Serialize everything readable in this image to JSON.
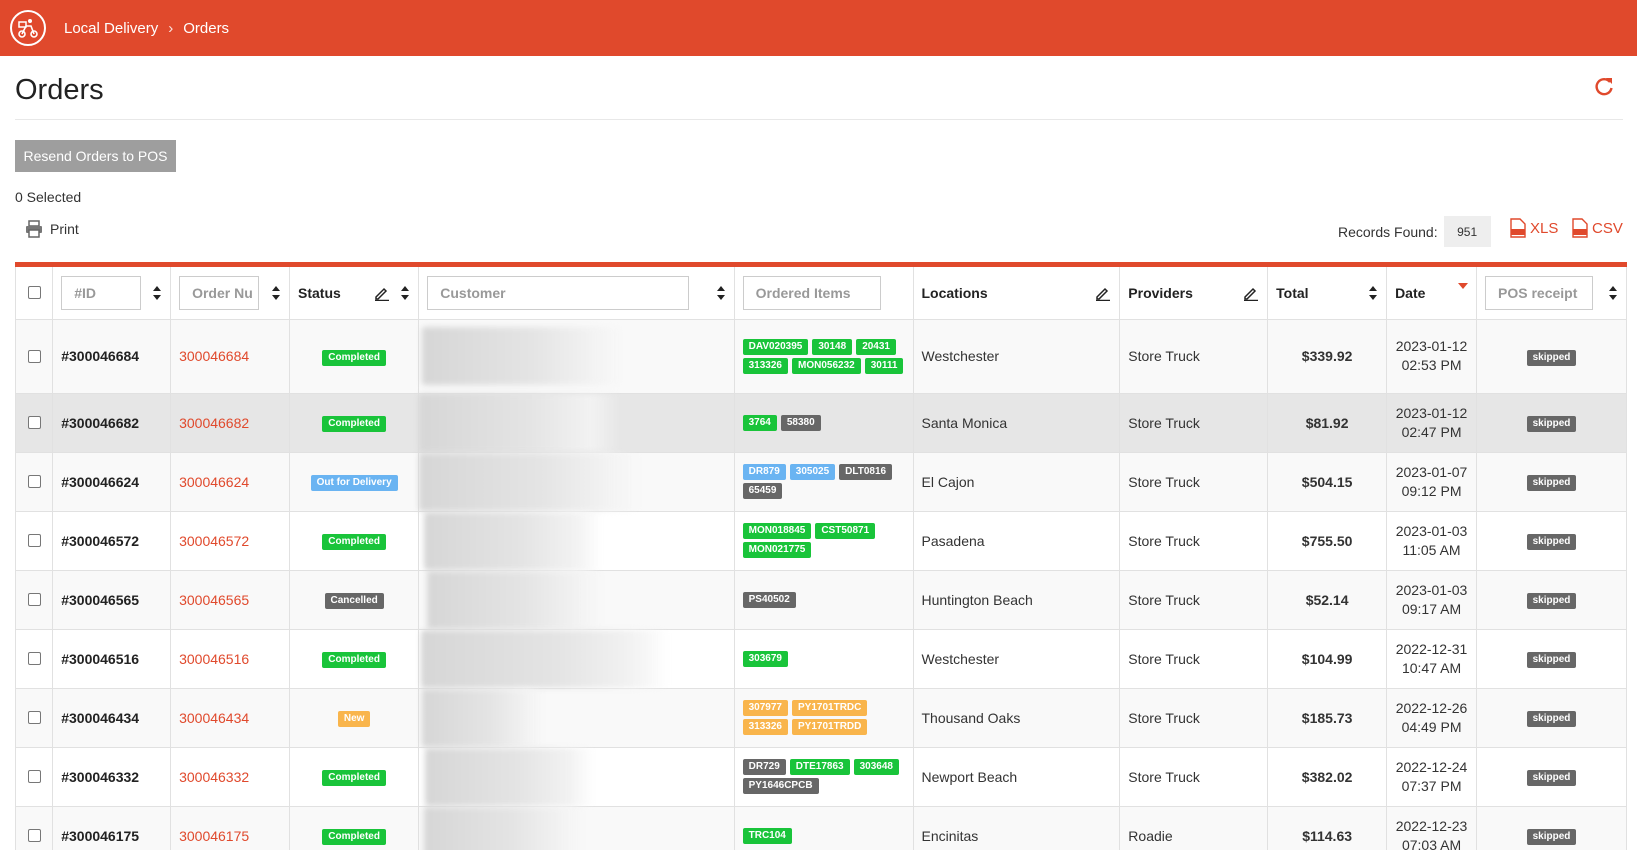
{
  "header": {
    "breadcrumb": [
      "Local Delivery",
      "Orders"
    ],
    "color": "#e0492c"
  },
  "page": {
    "title": "Orders",
    "resend_label": "Resend Orders to POS",
    "selected_text": "0 Selected",
    "print_label": "Print",
    "records_label": "Records Found:",
    "records_count": "951",
    "xls_label": "XLS",
    "csv_label": "CSV"
  },
  "table": {
    "filters": {
      "id_placeholder": "#ID",
      "order_placeholder": "Order Nu",
      "customer_placeholder": "Customer",
      "items_placeholder": "Ordered Items",
      "pos_placeholder": "POS receipt"
    },
    "headers": {
      "status": "Status",
      "locations": "Locations",
      "providers": "Providers",
      "total": "Total",
      "date": "Date"
    },
    "rows": [
      {
        "id": "#300046684",
        "order": "300046684",
        "status": "Completed",
        "status_type": "completed",
        "items": [
          {
            "label": "DAV020395",
            "color": "#19c43a"
          },
          {
            "label": "30148",
            "color": "#19c43a"
          },
          {
            "label": "20431",
            "color": "#19c43a"
          },
          {
            "label": "313326",
            "color": "#19c43a"
          },
          {
            "label": "MON056232",
            "color": "#19c43a"
          },
          {
            "label": "30111",
            "color": "#19c43a"
          }
        ],
        "location": "Westchester",
        "provider": "Store Truck",
        "total": "$339.92",
        "date": "2023-01-12",
        "time": "02:53 PM",
        "pos": "skipped"
      },
      {
        "id": "#300046682",
        "order": "300046682",
        "status": "Completed",
        "status_type": "completed",
        "items": [
          {
            "label": "3764",
            "color": "#19c43a"
          },
          {
            "label": "58380",
            "color": "#676767"
          }
        ],
        "location": "Santa Monica",
        "provider": "Store Truck",
        "total": "$81.92",
        "date": "2023-01-12",
        "time": "02:47 PM",
        "pos": "skipped"
      },
      {
        "id": "#300046624",
        "order": "300046624",
        "status": "Out for Delivery",
        "status_type": "out",
        "items": [
          {
            "label": "DR879",
            "color": "#6ab4f2"
          },
          {
            "label": "305025",
            "color": "#6ab4f2"
          },
          {
            "label": "DLT0816",
            "color": "#676767"
          },
          {
            "label": "65459",
            "color": "#676767"
          }
        ],
        "location": "El Cajon",
        "provider": "Store Truck",
        "total": "$504.15",
        "date": "2023-01-07",
        "time": "09:12 PM",
        "pos": "skipped"
      },
      {
        "id": "#300046572",
        "order": "300046572",
        "status": "Completed",
        "status_type": "completed",
        "items": [
          {
            "label": "MON018845",
            "color": "#19c43a"
          },
          {
            "label": "CST50871",
            "color": "#19c43a"
          },
          {
            "label": "MON021775",
            "color": "#19c43a"
          }
        ],
        "location": "Pasadena",
        "provider": "Store Truck",
        "total": "$755.50",
        "date": "2023-01-03",
        "time": "11:05 AM",
        "pos": "skipped"
      },
      {
        "id": "#300046565",
        "order": "300046565",
        "status": "Cancelled",
        "status_type": "cancelled",
        "items": [
          {
            "label": "PS40502",
            "color": "#676767"
          }
        ],
        "location": "Huntington Beach",
        "provider": "Store Truck",
        "total": "$52.14",
        "date": "2023-01-03",
        "time": "09:17 AM",
        "pos": "skipped"
      },
      {
        "id": "#300046516",
        "order": "300046516",
        "status": "Completed",
        "status_type": "completed",
        "items": [
          {
            "label": "303679",
            "color": "#19c43a"
          }
        ],
        "location": "Westchester",
        "provider": "Store Truck",
        "total": "$104.99",
        "date": "2022-12-31",
        "time": "10:47 AM",
        "pos": "skipped"
      },
      {
        "id": "#300046434",
        "order": "300046434",
        "status": "New",
        "status_type": "new",
        "items": [
          {
            "label": "307977",
            "color": "#f9b54c"
          },
          {
            "label": "PY1701TRDC",
            "color": "#f9b54c"
          },
          {
            "label": "313326",
            "color": "#f9b54c"
          },
          {
            "label": "PY1701TRDD",
            "color": "#f9b54c"
          }
        ],
        "location": "Thousand Oaks",
        "provider": "Store Truck",
        "total": "$185.73",
        "date": "2022-12-26",
        "time": "04:49 PM",
        "pos": "skipped"
      },
      {
        "id": "#300046332",
        "order": "300046332",
        "status": "Completed",
        "status_type": "completed",
        "items": [
          {
            "label": "DR729",
            "color": "#676767"
          },
          {
            "label": "DTE17863",
            "color": "#19c43a"
          },
          {
            "label": "303648",
            "color": "#19c43a"
          },
          {
            "label": "PY1646CPCB",
            "color": "#676767"
          }
        ],
        "location": "Newport Beach",
        "provider": "Store Truck",
        "total": "$382.02",
        "date": "2022-12-24",
        "time": "07:37 PM",
        "pos": "skipped"
      },
      {
        "id": "#300046175",
        "order": "300046175",
        "status": "Completed",
        "status_type": "completed",
        "items": [
          {
            "label": "TRC104",
            "color": "#19c43a"
          }
        ],
        "location": "Encinitas",
        "provider": "Roadie",
        "total": "$114.63",
        "date": "2022-12-23",
        "time": "07:03 AM",
        "pos": "skipped"
      }
    ]
  }
}
